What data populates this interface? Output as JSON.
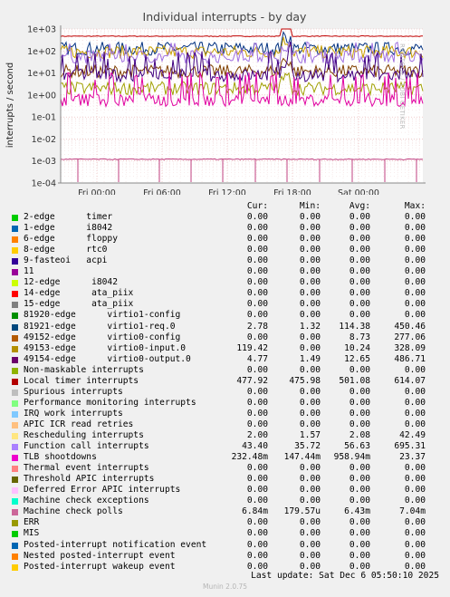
{
  "chart_data": {
    "type": "line",
    "title": "Individual interrupts - by day",
    "ylabel": "interrupts / second",
    "yscale": "log",
    "ylim": [
      0.0001,
      1000
    ],
    "y_ticks": [
      "1e+03",
      "1e+02",
      "1e+01",
      "1e+00",
      "1e-01",
      "1e-02",
      "1e-03",
      "1e-04"
    ],
    "x_ticks": [
      "Fri 00:00",
      "Fri 06:00",
      "Fri 12:00",
      "Fri 18:00",
      "Sat 00:00"
    ],
    "grid": true,
    "series": [
      {
        "name": "Local timer interrupts",
        "color": "#c00000",
        "level": 470
      },
      {
        "name": "81921-edge virtio1-req.0",
        "color": "#003080",
        "level": 130
      },
      {
        "name": "49153-edge virtio0-input.0",
        "color": "#c8a000",
        "level": 90
      },
      {
        "name": "Function call interrupts",
        "color": "#a070e0",
        "level": 55
      },
      {
        "name": "49152-edge virtio0-config",
        "color": "#804000",
        "level": 12
      },
      {
        "name": "49154-edge virtio0-output.0",
        "color": "#400080",
        "level": 8
      },
      {
        "name": "Rescheduling interrupts",
        "color": "#a0a000",
        "level": 2
      },
      {
        "name": "TLB shootdowns",
        "color": "#e000a0",
        "level": 0.6
      },
      {
        "name": "Machine check polls",
        "color": "#c04080",
        "level": 0.0012
      }
    ]
  },
  "legend": {
    "headers": {
      "cur": "Cur:",
      "min": "Min:",
      "avg": "Avg:",
      "max": "Max:"
    },
    "rows": [
      {
        "label": "2-edge      timer",
        "color": "#00cc00",
        "cur": "0.00",
        "min": "0.00",
        "avg": "0.00",
        "max": "0.00"
      },
      {
        "label": "1-edge      i8042",
        "color": "#0066b3",
        "cur": "0.00",
        "min": "0.00",
        "avg": "0.00",
        "max": "0.00"
      },
      {
        "label": "6-edge      floppy",
        "color": "#ff8000",
        "cur": "0.00",
        "min": "0.00",
        "avg": "0.00",
        "max": "0.00"
      },
      {
        "label": "8-edge      rtc0",
        "color": "#ffcc00",
        "cur": "0.00",
        "min": "0.00",
        "avg": "0.00",
        "max": "0.00"
      },
      {
        "label": "9-fasteoi   acpi",
        "color": "#330099",
        "cur": "0.00",
        "min": "0.00",
        "avg": "0.00",
        "max": "0.00"
      },
      {
        "label": "11",
        "color": "#990099",
        "cur": "0.00",
        "min": "0.00",
        "avg": "0.00",
        "max": "0.00"
      },
      {
        "label": "12-edge      i8042",
        "color": "#ccff00",
        "cur": "0.00",
        "min": "0.00",
        "avg": "0.00",
        "max": "0.00"
      },
      {
        "label": "14-edge      ata_piix",
        "color": "#ff0000",
        "cur": "0.00",
        "min": "0.00",
        "avg": "0.00",
        "max": "0.00"
      },
      {
        "label": "15-edge      ata_piix",
        "color": "#808080",
        "cur": "0.00",
        "min": "0.00",
        "avg": "0.00",
        "max": "0.00"
      },
      {
        "label": "81920-edge      virtio1-config",
        "color": "#008f00",
        "cur": "0.00",
        "min": "0.00",
        "avg": "0.00",
        "max": "0.00"
      },
      {
        "label": "81921-edge      virtio1-req.0",
        "color": "#00487d",
        "cur": "2.78",
        "min": "1.32",
        "avg": "114.38",
        "max": "450.46"
      },
      {
        "label": "49152-edge      virtio0-config",
        "color": "#b35a00",
        "cur": "0.00",
        "min": "0.00",
        "avg": "8.73",
        "max": "277.06"
      },
      {
        "label": "49153-edge      virtio0-input.0",
        "color": "#b38f00",
        "cur": "119.42",
        "min": "0.00",
        "avg": "10.24",
        "max": "328.09"
      },
      {
        "label": "49154-edge      virtio0-output.0",
        "color": "#6b006b",
        "cur": "4.77",
        "min": "1.49",
        "avg": "12.65",
        "max": "486.71"
      },
      {
        "label": "Non-maskable interrupts",
        "color": "#8fb300",
        "cur": "0.00",
        "min": "0.00",
        "avg": "0.00",
        "max": "0.00"
      },
      {
        "label": "Local timer interrupts",
        "color": "#b30000",
        "cur": "477.92",
        "min": "475.98",
        "avg": "501.08",
        "max": "614.07"
      },
      {
        "label": "Spurious interrupts",
        "color": "#bebebe",
        "cur": "0.00",
        "min": "0.00",
        "avg": "0.00",
        "max": "0.00"
      },
      {
        "label": "Performance monitoring interrupts",
        "color": "#80ff80",
        "cur": "0.00",
        "min": "0.00",
        "avg": "0.00",
        "max": "0.00"
      },
      {
        "label": "IRQ work interrupts",
        "color": "#80c9ff",
        "cur": "0.00",
        "min": "0.00",
        "avg": "0.00",
        "max": "0.00"
      },
      {
        "label": "APIC ICR read retries",
        "color": "#ffc080",
        "cur": "0.00",
        "min": "0.00",
        "avg": "0.00",
        "max": "0.00"
      },
      {
        "label": "Rescheduling interrupts",
        "color": "#ffe680",
        "cur": "2.00",
        "min": "1.57",
        "avg": "2.08",
        "max": "42.49"
      },
      {
        "label": "Function call interrupts",
        "color": "#aa80ff",
        "cur": "43.40",
        "min": "35.72",
        "avg": "56.63",
        "max": "695.31"
      },
      {
        "label": "TLB shootdowns",
        "color": "#ee00cc",
        "cur": "232.48m",
        "min": "147.44m",
        "avg": "958.94m",
        "max": "23.37"
      },
      {
        "label": "Thermal event interrupts",
        "color": "#ff8080",
        "cur": "0.00",
        "min": "0.00",
        "avg": "0.00",
        "max": "0.00"
      },
      {
        "label": "Threshold APIC interrupts",
        "color": "#666600",
        "cur": "0.00",
        "min": "0.00",
        "avg": "0.00",
        "max": "0.00"
      },
      {
        "label": "Deferred Error APIC interrupts",
        "color": "#ffbfff",
        "cur": "0.00",
        "min": "0.00",
        "avg": "0.00",
        "max": "0.00"
      },
      {
        "label": "Machine check exceptions",
        "color": "#00ffcc",
        "cur": "0.00",
        "min": "0.00",
        "avg": "0.00",
        "max": "0.00"
      },
      {
        "label": "Machine check polls",
        "color": "#cc6699",
        "cur": "6.84m",
        "min": "179.57u",
        "avg": "6.43m",
        "max": "7.04m"
      },
      {
        "label": "ERR",
        "color": "#999900",
        "cur": "0.00",
        "min": "0.00",
        "avg": "0.00",
        "max": "0.00"
      },
      {
        "label": "MIS",
        "color": "#00cc00",
        "cur": "0.00",
        "min": "0.00",
        "avg": "0.00",
        "max": "0.00"
      },
      {
        "label": "Posted-interrupt notification event",
        "color": "#0066b3",
        "cur": "0.00",
        "min": "0.00",
        "avg": "0.00",
        "max": "0.00"
      },
      {
        "label": "Nested posted-interrupt event",
        "color": "#ff8000",
        "cur": "0.00",
        "min": "0.00",
        "avg": "0.00",
        "max": "0.00"
      },
      {
        "label": "Posted-interrupt wakeup event",
        "color": "#ffcc00",
        "cur": "0.00",
        "min": "0.00",
        "avg": "0.00",
        "max": "0.00"
      }
    ]
  },
  "last_update": "Last update: Sat Dec  6 05:50:10 2025",
  "footer": "Munin 2.0.75",
  "side_label": "RRDTOOL / TOBI OETIKER"
}
